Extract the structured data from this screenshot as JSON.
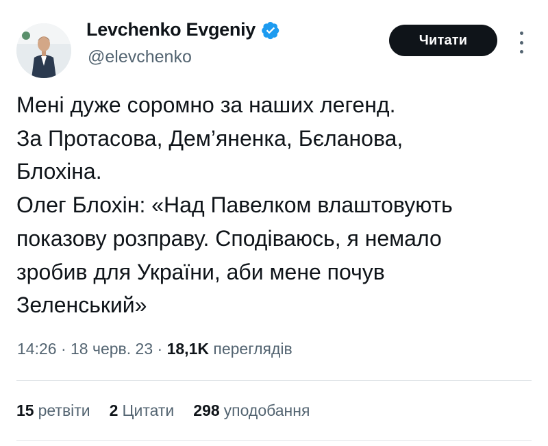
{
  "author": {
    "name": "Levchenko Evgeniy",
    "handle": "@elevchenko"
  },
  "follow_button": "Читати",
  "tweet_lines": [
    "Мені дуже соромно за наших легенд.",
    "За Протасова, Дем’яненка, Бєланова,",
    "Блохіна.",
    "Олег Блохін: «Над Павелком влаштовують",
    "показову розправу. Сподіваюсь, я немало",
    "зробив для України, аби мене почув",
    "Зеленський»"
  ],
  "meta": {
    "time": "14:26",
    "date": "18 черв. 23",
    "views_count": "18,1K",
    "views_label": "переглядів"
  },
  "stats": {
    "retweets_count": "15",
    "retweets_label": "ретвіти",
    "quotes_count": "2",
    "quotes_label": "Цитати",
    "likes_count": "298",
    "likes_label": "уподобання"
  },
  "colors": {
    "text": "#0f1419",
    "secondary": "#536471",
    "verified": "#1d9bf0",
    "button_bg": "#0f1419"
  }
}
